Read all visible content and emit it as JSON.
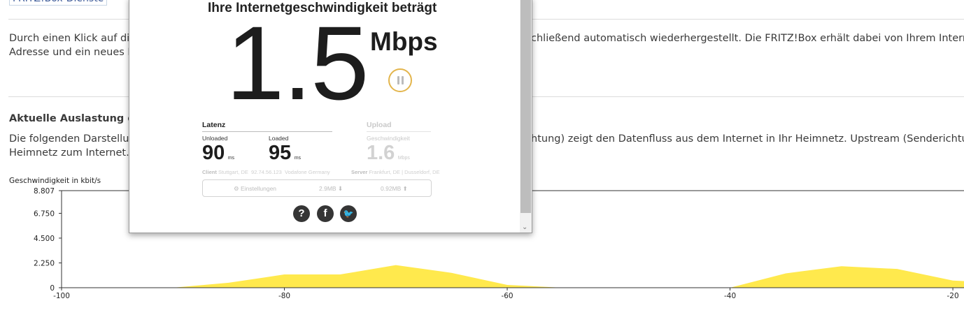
{
  "page": {
    "breadcrumb": "FRITZ!Box-Dienste",
    "intro_line1_left": "Durch einen Klick auf die S",
    "intro_line1_right": "chließend automatisch wiederhergestellt. Die FRITZ!Box erhält dabei von Ihrem Internetanbie",
    "intro_line2_left": "Adresse und ein neues IPv",
    "section_title": "Aktuelle Auslastung der In",
    "desc_line1_left": "Die folgenden Darstellung",
    "desc_line1_right": "htung) zeigt den Datenfluss aus dem Internet in Ihr Heimnetz. Upstream (Senderichtung) zeig",
    "desc_line2_left": "Heimnetz zum Internet."
  },
  "popup": {
    "title": "Ihre Internetgeschwindigkeit beträgt",
    "speed": "1.5",
    "unit": "Mbps",
    "latency_label": "Latenz",
    "unloaded_label": "Unloaded",
    "unloaded_value": "90",
    "loaded_label": "Loaded",
    "loaded_value": "95",
    "ms": "ms",
    "upload_label": "Upload",
    "upload_sub": "Geschwindigkeit",
    "upload_value": "1.6",
    "upload_unit": "Mbps",
    "client_label": "Client",
    "client_city": "Stuttgart, DE",
    "client_ip": "92.74.56.123",
    "client_isp": "Vodafone Germany",
    "server_label": "Server",
    "server_value": "Frankfurt, DE  |  Dusseldorf, DE",
    "settings_label": "Einstellungen",
    "download_size": "2.9MB",
    "upload_size": "0.92MB",
    "settings_icon": "gear-icon",
    "social_icons": [
      "help-icon",
      "facebook-icon",
      "twitter-icon"
    ]
  },
  "chart_data": {
    "type": "area",
    "ylabel": "Geschwindigkeit in kbit/s",
    "y_ticks": [
      "8.807",
      "6.750",
      "4.500",
      "2.250",
      "0"
    ],
    "y_tick_values": [
      8807,
      6750,
      4500,
      2250,
      0
    ],
    "x_ticks": [
      "-100",
      "-80",
      "-60",
      "-40",
      "-20"
    ],
    "x_tick_values": [
      -100,
      -80,
      -60,
      -40,
      -20
    ],
    "ylim": [
      0,
      8807
    ],
    "xlim": [
      -100,
      -19
    ],
    "fill_color": "#ffe94d",
    "x": [
      -100,
      -95,
      -90,
      -85,
      -80,
      -75,
      -70,
      -65,
      -60,
      -55,
      -50,
      -45,
      -40,
      -35,
      -30,
      -25,
      -20,
      -19
    ],
    "values": [
      0,
      0,
      0,
      450,
      1200,
      1200,
      2050,
      1350,
      250,
      0,
      0,
      0,
      0,
      1300,
      1950,
      1700,
      650,
      600
    ]
  }
}
